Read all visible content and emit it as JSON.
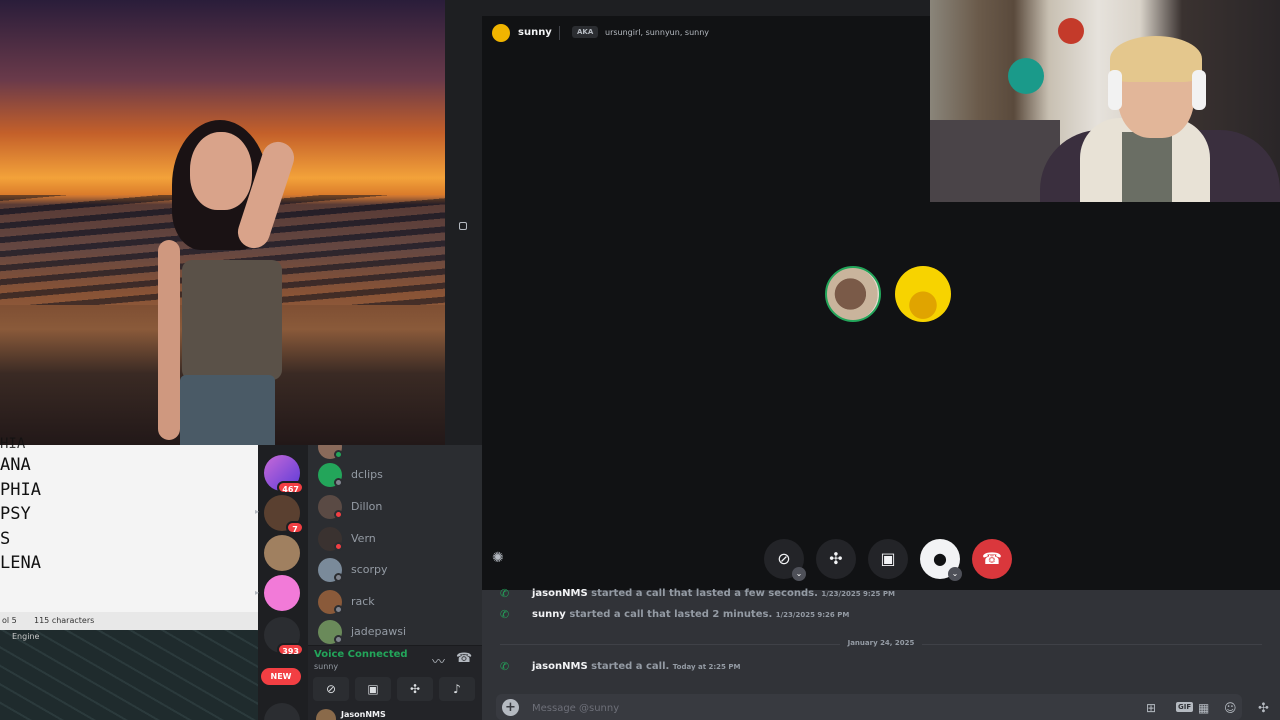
{
  "editor": {
    "lines": [
      "ANA",
      "PHIA",
      "PSY",
      "S",
      "LENA"
    ],
    "cut_line": "HIA",
    "status_col": "ol 5",
    "status_chars": "115 characters",
    "engine_label": "Engine"
  },
  "servers": {
    "badges": [
      "467",
      "7",
      "393"
    ],
    "new_label": "NEW"
  },
  "dm_list": {
    "items": [
      {
        "name": "dclips",
        "status": "offline",
        "avatar": "#23a55a"
      },
      {
        "name": "Dillon",
        "status": "dnd",
        "avatar": "#5a4a44"
      },
      {
        "name": "Vern",
        "status": "dnd",
        "avatar": "#3a3230"
      },
      {
        "name": "scorpy",
        "status": "offline",
        "avatar": "#7a8a9a"
      },
      {
        "name": "rack",
        "status": "offline",
        "avatar": "#8a5a3a"
      },
      {
        "name": "jadepawsi",
        "status": "offline",
        "avatar": "#6a8a5a"
      }
    ]
  },
  "voice": {
    "connected_label": "Voice Connected",
    "channel": "sunny"
  },
  "user": {
    "name": "JasonNMS"
  },
  "call": {
    "header_name": "sunny",
    "aka_label": "AKA",
    "aka_names": "ursungirl, sunnyun, sunny"
  },
  "chat": {
    "messages": [
      {
        "who": "jasonNMS",
        "text": "started a call that lasted a few seconds.",
        "ts": "1/23/2025 9:25 PM"
      },
      {
        "who": "sunny",
        "text": "started a call that lasted 2 minutes.",
        "ts": "1/23/2025 9:26 PM"
      },
      {
        "who": "jasonNMS",
        "text": "started a call.",
        "ts": "Today at 2:25 PM"
      }
    ],
    "date_divider": "January 24, 2025",
    "placeholder": "Message @sunny",
    "gif_label": "GIF"
  },
  "icons": {
    "phone": "phone-icon",
    "camera_off": "camera-off-icon",
    "activities": "activities-icon",
    "screenshare": "screenshare-icon",
    "mic": "microphone-icon",
    "hangup": "hangup-icon"
  },
  "colors": {
    "online": "#23a55a",
    "danger": "#da373c",
    "bg_call": "#111214",
    "bg_chat": "#313338"
  }
}
